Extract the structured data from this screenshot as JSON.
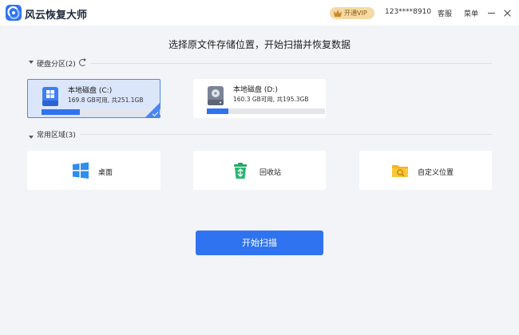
{
  "app": {
    "title": "风云恢复大师",
    "vip_label": "开通VIP",
    "account": "123****8910",
    "customer_service": "客服",
    "menu": "菜单"
  },
  "main": {
    "heading": "选择原文件存储位置，开始扫描并恢复数据"
  },
  "disk_section": {
    "title": "硬盘分区(2)",
    "disks": [
      {
        "name": "本地磁盘 (C:)",
        "size_text": "169.8 GB可用, 共251.1GB",
        "used_fraction": 0.32,
        "selected": true,
        "icon": "windows-drive-icon"
      },
      {
        "name": "本地磁盘 (D:)",
        "size_text": "160.3 GB可用, 共195.3GB",
        "used_fraction": 0.18,
        "selected": false,
        "icon": "hard-drive-icon"
      }
    ]
  },
  "common_section": {
    "title": "常用区域(3)",
    "items": [
      {
        "label": "桌面",
        "icon": "windows-desktop-icon"
      },
      {
        "label": "回收站",
        "icon": "recycle-bin-icon"
      },
      {
        "label": "自定义位置",
        "icon": "folder-search-icon"
      }
    ]
  },
  "actions": {
    "start_scan": "开始扫描"
  },
  "colors": {
    "accent": "#2f73f0",
    "selected_bg": "#dbe6fb",
    "vip_bg": "#f6d9a5",
    "recycle_green": "#2bb673",
    "folder_yellow": "#f5b51b"
  }
}
